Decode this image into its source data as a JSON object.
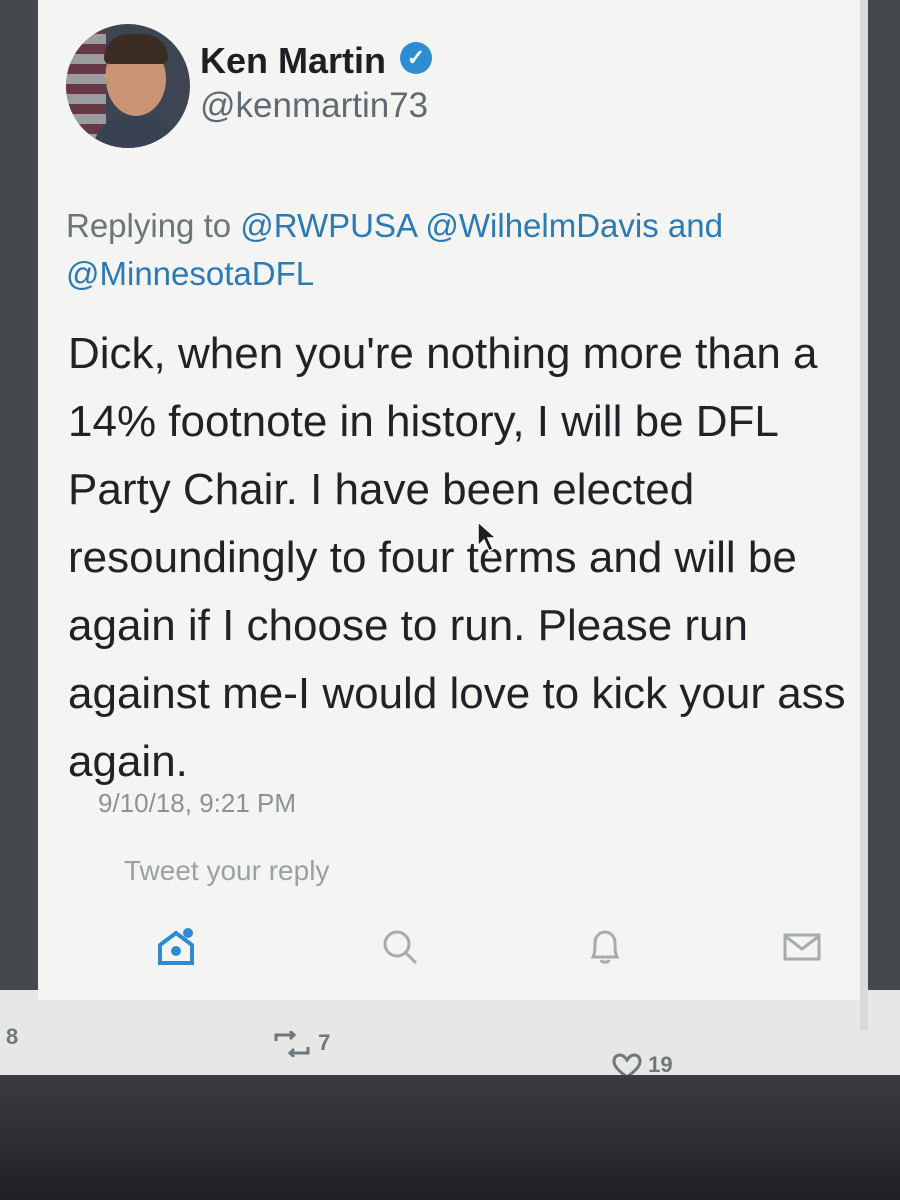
{
  "tweet": {
    "display_name": "Ken Martin",
    "handle": "@kenmartin73",
    "reply_prefix": "Replying to",
    "reply_mentions": [
      "@RWPUSA",
      "@WilhelmDavis"
    ],
    "reply_joiner": "and",
    "reply_last": "@MinnesotaDFL",
    "text_lines": [
      "Dick, when you're nothing more than a",
      "14% footnote in history, I will be DFL",
      "Party Chair.  I have been elected",
      "resoundingly to four terms and will be",
      "again if I choose to run.  Please run",
      "against me-I would love to kick your ass",
      "again."
    ],
    "timestamp": "9/10/18, 9:21 PM"
  },
  "reply": {
    "placeholder": "Tweet your reply"
  },
  "nav": {
    "icons": [
      "home-icon",
      "search-icon",
      "notifications-icon",
      "messages-icon"
    ],
    "accent": "#2c8dd3"
  },
  "timeline_behind": {
    "left_count": "8",
    "retweet_count": "7",
    "like_count": "19"
  },
  "colors": {
    "card": "#f4f5f2",
    "text": "#1f2226",
    "muted": "#6a757c",
    "link": "#2c79b8",
    "verified": "#2c8dd3"
  }
}
